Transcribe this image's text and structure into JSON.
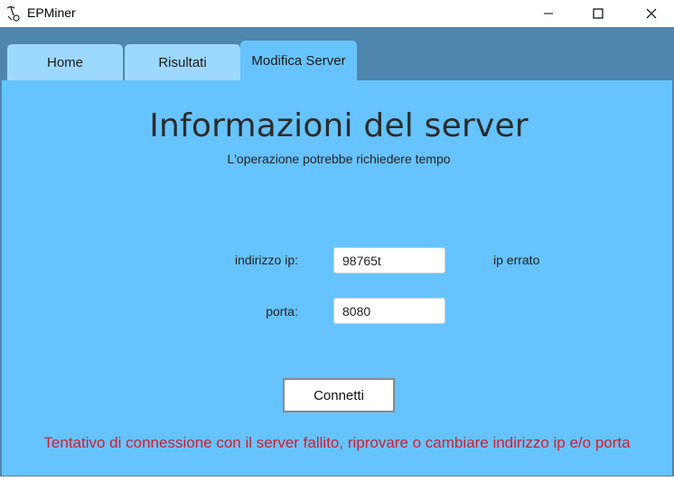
{
  "window": {
    "title": "EPMiner",
    "icon": "pickaxe-miner-icon"
  },
  "tabs": [
    {
      "label": "Home",
      "selected": false
    },
    {
      "label": "Risultati",
      "selected": false
    },
    {
      "label": "Modifica Server",
      "selected": true
    }
  ],
  "main": {
    "heading": "Informazioni del server",
    "subheading": "L'operazione potrebbe richiedere tempo",
    "ip_label": "indirizzo ip:",
    "ip_value": "98765t",
    "ip_error": "ip errato",
    "port_label": "porta:",
    "port_value": "8080",
    "connect_label": "Connetti",
    "error_message": "Tentativo di connessione con il server fallito, riprovare o cambiare indirizzo ip e/o porta"
  },
  "colors": {
    "tab_strip": "#4f86ad",
    "panel": "#66c3fd",
    "tab_inactive": "#9dd9ff",
    "error_text": "#d71b2b"
  }
}
